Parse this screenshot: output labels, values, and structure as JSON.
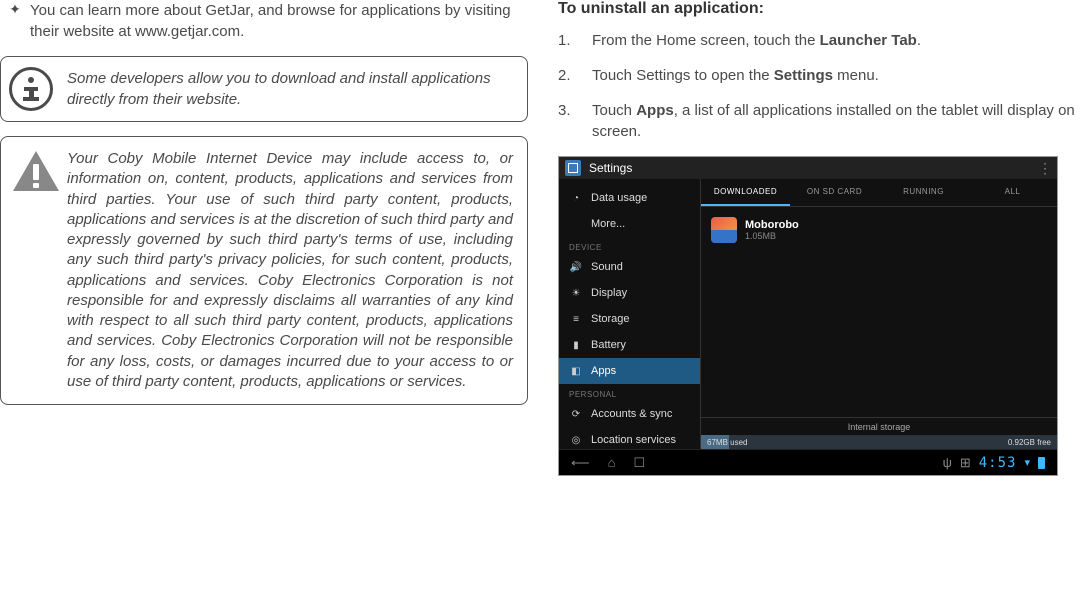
{
  "left": {
    "bullet_symbol": "✦",
    "bullet_text": "You can learn more about GetJar, and browse for applications by visiting their website at www.getjar.com.",
    "info_text": "Some developers allow you to download and install applications directly from their website.",
    "warn_text": "Your Coby Mobile Internet Device may include access to, or information on, content, products, applications and services from third parties. Your use of such third party content, products, applications and services is at the discretion of such third party and expressly governed by such third party's terms of use, including any such third party's privacy policies, for such content, products, applications and services. Coby Electronics Corporation is not responsible for and expressly disclaims all warranties of any kind with respect to all such third party content, products, applications and services. Coby Electronics Corporation will not be responsible for any loss, costs, or damages incurred due to your access to or use of third party content, products, applications or services."
  },
  "right": {
    "heading": "To uninstall an application:",
    "steps": [
      {
        "num": "1.",
        "pre": "From the Home screen, touch the ",
        "bold": "Launcher Tab",
        "post": "."
      },
      {
        "num": "2.",
        "pre": "Touch Settings to open the ",
        "bold": "Settings",
        "post": " menu."
      },
      {
        "num": "3.",
        "pre": "Touch ",
        "bold": "Apps",
        "post": ", a list of all applications installed on the tablet will display on screen."
      }
    ]
  },
  "tablet": {
    "title": "Settings",
    "menu_dots": "⋮",
    "sidebar": {
      "items_top": [
        {
          "icon": "◔",
          "label": "Data usage"
        },
        {
          "icon": "",
          "label": "More..."
        }
      ],
      "section_device": "DEVICE",
      "items_device": [
        {
          "icon": "🔊",
          "label": "Sound"
        },
        {
          "icon": "☀",
          "label": "Display"
        },
        {
          "icon": "≡",
          "label": "Storage"
        },
        {
          "icon": "▮",
          "label": "Battery"
        },
        {
          "icon": "◧",
          "label": "Apps",
          "selected": true
        }
      ],
      "section_personal": "PERSONAL",
      "items_personal": [
        {
          "icon": "⟳",
          "label": "Accounts & sync"
        },
        {
          "icon": "◎",
          "label": "Location services"
        }
      ]
    },
    "tabs": [
      {
        "label": "DOWNLOADED",
        "active": true
      },
      {
        "label": "ON SD CARD"
      },
      {
        "label": "RUNNING"
      },
      {
        "label": "ALL"
      }
    ],
    "app": {
      "name": "Moborobo",
      "size": "1.05MB"
    },
    "storage": {
      "label": "Internal storage",
      "used": "67MB used",
      "free": "0.92GB free"
    },
    "nav": {
      "back": "⟵",
      "home": "⌂",
      "recent": "☐",
      "usb": "ψ",
      "debug": "⊞",
      "clock": "4:53",
      "wifi": "▾"
    }
  }
}
